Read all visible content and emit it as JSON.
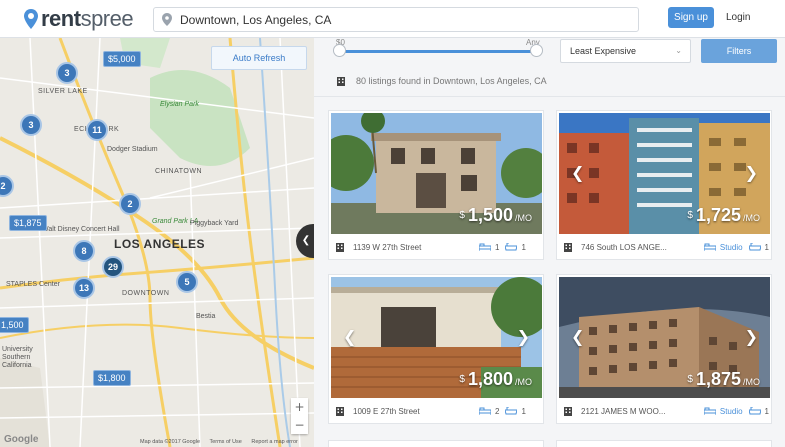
{
  "header": {
    "logo_bold": "rent",
    "logo_light": "spree",
    "search_value": "Downtown, Los Angeles, CA",
    "signup_label": "Sign up",
    "login_label": "Login"
  },
  "map": {
    "auto_refresh_label": "Auto Refresh",
    "labels": {
      "silver_lake": "SILVER LAKE",
      "echo_park": "ECHO PARK",
      "elysian_park": "Elysian Park",
      "dodger_stadium": "Dodger Stadium",
      "chinatown": "CHINATOWN",
      "grand_park": "Grand Park LA",
      "disney": "Walt Disney Concert Hall",
      "piggyback": "Piggyback Yard",
      "los_angeles": "LOS ANGELES",
      "staples": "STAPLES Center",
      "downtown": "DOWNTOWN",
      "bestia": "Bestia",
      "university": "University",
      "southern": "Southern",
      "california": "California"
    },
    "clusters": [
      "3",
      "3",
      "11",
      "2",
      "2",
      "8",
      "29",
      "13",
      "5"
    ],
    "price_tags": [
      "$5,000",
      "$1,875",
      "1,500",
      "$1,800"
    ],
    "zoom_in": "+",
    "zoom_out": "−",
    "google": "Google",
    "footer": {
      "data": "Map data ©2017 Google",
      "terms": "Terms of Use",
      "report": "Report a map error"
    }
  },
  "filters": {
    "slider_min": "$0",
    "slider_max": "Any",
    "sort_value": "Least Expensive",
    "filters_label": "Filters",
    "found_text": "80 listings found in Downtown, Los Angeles, CA"
  },
  "listings": [
    {
      "currency": "$",
      "price": "1,500",
      "per": "/MO",
      "address": "1139 W 27th Street",
      "beds": "1",
      "baths": "1"
    },
    {
      "currency": "$",
      "price": "1,725",
      "per": "/MO",
      "address": "746 South LOS ANGE...",
      "beds": "Studio",
      "baths": "1"
    },
    {
      "currency": "$",
      "price": "1,800",
      "per": "/MO",
      "address": "1009 E 27th Street",
      "beds": "2",
      "baths": "1"
    },
    {
      "currency": "$",
      "price": "1,875",
      "per": "/MO",
      "address": "2121 JAMES M WOO...",
      "beds": "Studio",
      "baths": "1"
    }
  ],
  "colors": {
    "brand_blue": "#4a90d9",
    "cluster_blue": "#3d77b8",
    "map_bg": "#eceae4"
  }
}
